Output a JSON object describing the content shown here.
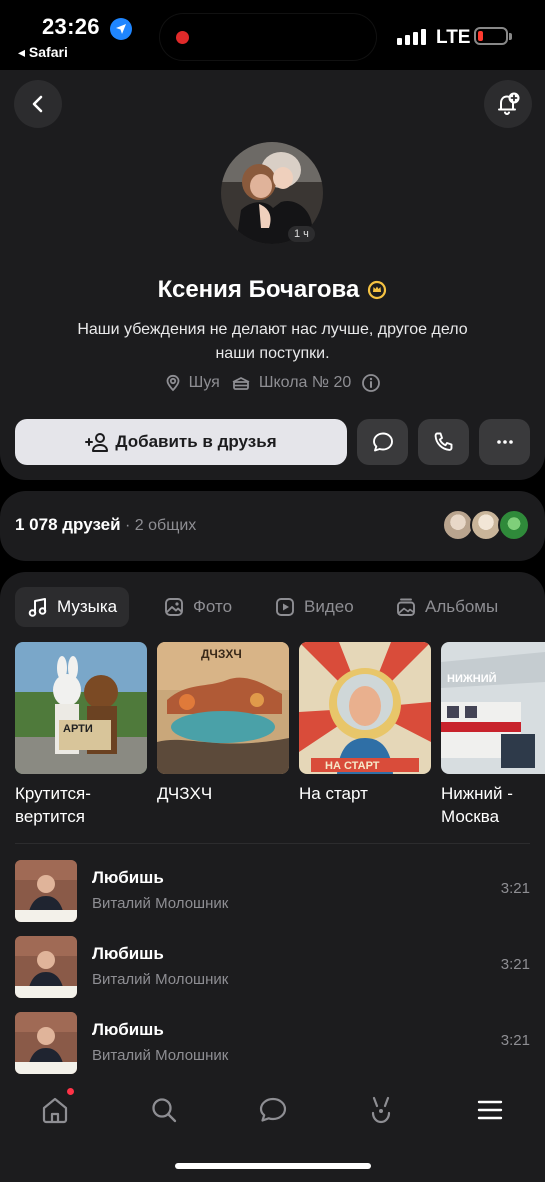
{
  "status_bar": {
    "time": "23:26",
    "back_to_app": "◂ Safari",
    "network": "LTE"
  },
  "profile": {
    "avatar_badge": "1 ч",
    "name": "Ксения Бочагова",
    "status_line1": "Наши убеждения не делают нас лучше, другое дело",
    "status_line2": "наши поступки.",
    "city": "Шуя",
    "school": "Школа № 20",
    "add_friend_label": "Добавить в друзья"
  },
  "friends": {
    "count": "1 078 друзей",
    "mutual": " · 2 общих"
  },
  "tabs": [
    {
      "label": "Музыка",
      "icon": "music-note-icon"
    },
    {
      "label": "Фото",
      "icon": "photo-icon"
    },
    {
      "label": "Видео",
      "icon": "video-icon"
    },
    {
      "label": "Альбомы",
      "icon": "albums-icon"
    }
  ],
  "albums": [
    {
      "title": "Крутится-вертится"
    },
    {
      "title": "ДЧЗХЧ"
    },
    {
      "title": "На старт"
    },
    {
      "title": "Нижний - Москва"
    }
  ],
  "tracks": [
    {
      "title": "Любишь",
      "artist": "Виталий Молошник",
      "duration": "3:21"
    },
    {
      "title": "Любишь",
      "artist": "Виталий Молошник",
      "duration": "3:21"
    },
    {
      "title": "Любишь",
      "artist": "Виталий Молошник",
      "duration": "3:21"
    }
  ],
  "nav": [
    "home-icon",
    "search-icon",
    "messages-icon",
    "clips-icon",
    "menu-icon"
  ],
  "colors": {
    "background": "#000000",
    "card": "#1c1c1e",
    "button_light": "#e5e5ea",
    "button_dark": "#3a3a3c",
    "secondary_text": "#8e8e93",
    "accent_gold": "#f5c242",
    "badge_red": "#ff3347"
  }
}
